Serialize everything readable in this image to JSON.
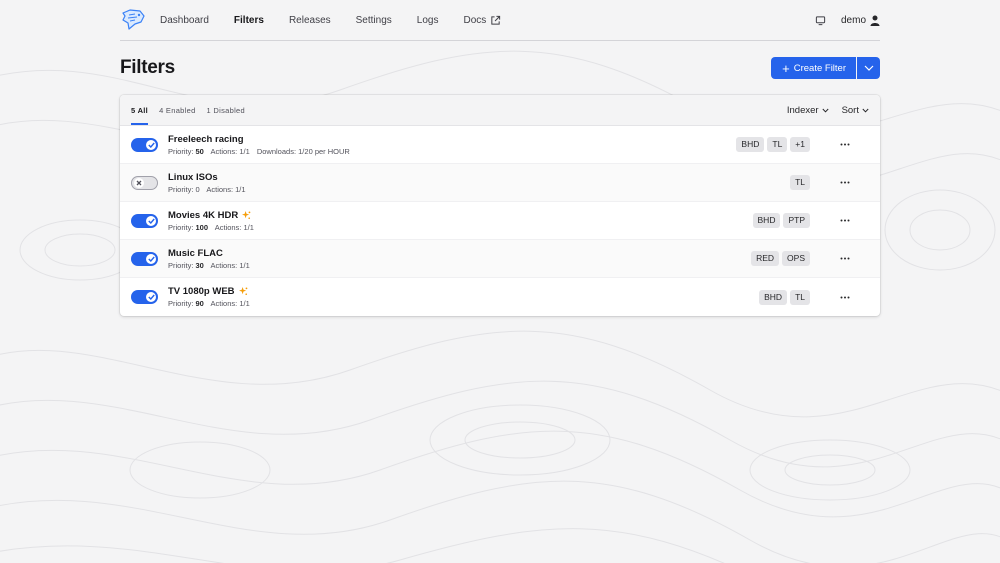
{
  "nav": {
    "items": [
      "Dashboard",
      "Filters",
      "Releases",
      "Settings",
      "Logs"
    ],
    "docs": "Docs",
    "user": "demo"
  },
  "page": {
    "title": "Filters",
    "create_label": "Create Filter"
  },
  "tabs": [
    "5 All",
    "4 Enabled",
    "1 Disabled"
  ],
  "controls": {
    "indexer": "Indexer",
    "sort": "Sort"
  },
  "labels": {
    "priority": "Priority:",
    "actions": "Actions:",
    "downloads": "Downloads:"
  },
  "filters": [
    {
      "name": "Freeleech racing",
      "enabled": true,
      "priority": "50",
      "actions": "1/1",
      "downloads": "1/20 per HOUR",
      "tags": [
        "BHD",
        "TL",
        "+1"
      ]
    },
    {
      "name": "Linux ISOs",
      "enabled": false,
      "priority": "0",
      "actions": "1/1",
      "tags": [
        "TL"
      ]
    },
    {
      "name": "Movies 4K HDR",
      "enabled": true,
      "priority": "100",
      "actions": "1/1",
      "sparkle": true,
      "tags": [
        "BHD",
        "PTP"
      ]
    },
    {
      "name": "Music FLAC",
      "enabled": true,
      "priority": "30",
      "actions": "1/1",
      "tags": [
        "RED",
        "OPS"
      ]
    },
    {
      "name": "TV 1080p WEB",
      "enabled": true,
      "priority": "90",
      "actions": "1/1",
      "sparkle": true,
      "tags": [
        "BHD",
        "TL"
      ]
    }
  ],
  "colors": {
    "accent": "#2563eb",
    "sparkle": "#f59e0b"
  },
  "icons": [
    "app-logo-icon",
    "external-link-icon",
    "monitor-icon",
    "user-icon",
    "plus-icon",
    "chevron-down-icon",
    "check-icon",
    "x-icon",
    "sparkle-icon",
    "more-horizontal-icon"
  ]
}
